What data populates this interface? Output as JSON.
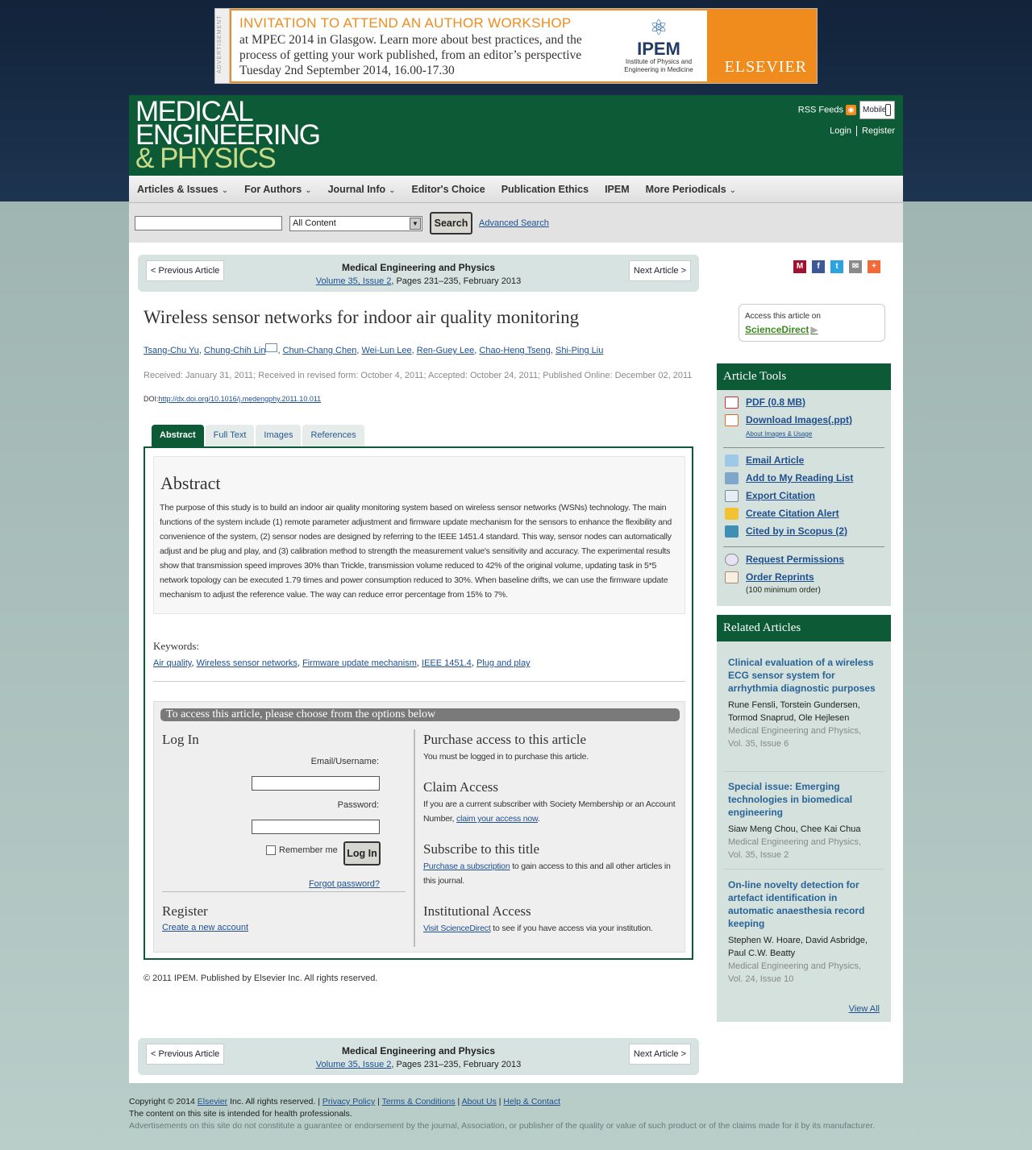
{
  "ad": {
    "side_label": "ADVERTISEMENT",
    "title": "INVITATION TO ATTEND AN AUTHOR WORKSHOP",
    "body": "at MPEC 2014 in Glasgow. Learn more about best practices, and the process of getting your work published, from an editor’s perspective Tuesday 2nd September 2014, 16.00-17.30",
    "logo_name": "IPEM",
    "logo_sub": "Institute of Physics and Engineering in Medicine",
    "publisher": "ELSEVIER"
  },
  "header": {
    "logo_line1": "MEDICAL",
    "logo_line2": "ENGINEERING",
    "logo_line3": "& PHYSICS",
    "rss": "RSS Feeds",
    "mobile": "Mobile",
    "login": "Login",
    "register": "Register"
  },
  "nav": [
    {
      "label": "Articles & Issues",
      "caret": "⌄"
    },
    {
      "label": "For Authors",
      "caret": "⌄"
    },
    {
      "label": "Journal Info",
      "caret": "⌄"
    },
    {
      "label": "Editor's Choice",
      "caret": ""
    },
    {
      "label": "Publication Ethics",
      "caret": ""
    },
    {
      "label": "IPEM",
      "caret": ""
    },
    {
      "label": "More Periodicals",
      "caret": "⌄"
    }
  ],
  "search": {
    "value": "",
    "scope": "All Content",
    "button": "Search",
    "advanced": "Advanced Search"
  },
  "artnav": {
    "prev": "< Previous Article",
    "next": "Next Article >",
    "journal": "Medical Engineering and Physics",
    "volume_link": "Volume 35, Issue 2",
    "pages": ", Pages 231–235, February 2013"
  },
  "article": {
    "title": "Wireless sensor networks for indoor air quality monitoring",
    "authors": [
      "Tsang-Chu Yu",
      "Chung-Chih Lin",
      "Chun-Chang Chen",
      "Wei-Lun Lee",
      "Ren-Guey Lee",
      "Chao-Heng Tseng",
      "Shi-Ping Liu"
    ],
    "dates": "Received: January 31, 2011; Received in revised form: October 4, 2011; Accepted: October 24, 2011; Published Online: December 02, 2011",
    "doi_label": "DOI:",
    "doi": "http://dx.doi.org/10.1016/j.medengphy.2011.10.011",
    "tabs": [
      "Abstract",
      "Full Text",
      "Images",
      "References"
    ],
    "abstract_heading": "Abstract",
    "abstract": "The purpose of this study is to build an indoor air quality monitoring system based on wireless sensor networks (WSNs) technology. The main functions of the system include (1) remote parameter adjustment and firmware update mechanism for the sensors to enhance the flexibility and convenience of the system, (2) sensor nodes are designed by referring to the IEEE 1451.4 standard. This way, sensor nodes can automatically adjust and be plug and play, and (3) calibration method to strength the measurement value's sensitivity and accuracy. The experimental results show that transmission speed improves 30% than Trickle, transmission volume reduced to 42% of the original volume, updating task in 5*5 network topology can be executed 1.79 times and power consumption reduced to 30%. When baseline drifts, we can use the firmware update mechanism to adjust the reference value. The way can reduce error percentage from 15% to 7%.",
    "keywords_label": "Keywords:",
    "keywords": [
      "Air quality",
      "Wireless sensor networks",
      "Firmware update mechanism",
      "IEEE 1451.4",
      "Plug and play"
    ],
    "copyright": "© 2011 IPEM. Published by Elsevier Inc. All rights reserved."
  },
  "access": {
    "bar": "To access this article, please choose from the options below",
    "login_heading": "Log In",
    "email_label": "Email/Username:",
    "password_label": "Password:",
    "remember": "Remember me",
    "login_button": "Log In",
    "forgot": "Forgot password?",
    "register_heading": "Register",
    "register_link": "Create a new account",
    "purchase_heading": "Purchase access to this article",
    "purchase_text": "You must be logged in to purchase this article.",
    "claim_heading": "Claim Access",
    "claim_text": "If you are a current subscriber with Society Membership or an Account Number,",
    "claim_link": "claim your access now",
    "subscribe_heading": "Subscribe to this title",
    "subscribe_link": "Purchase a subscription",
    "subscribe_text": "to gain access to this and all other articles in this journal.",
    "inst_heading": "Institutional Access",
    "inst_link": "Visit ScienceDirect",
    "inst_text": "to see if you have access via your institution."
  },
  "sidebar": {
    "sd_label": "Access this article on",
    "sd_link": "ScienceDirect",
    "tools_heading": "Article Tools",
    "pdf": "PDF (0.8 MB)",
    "download_images": "Download Images(.ppt)",
    "about_images": "About Images & Usage",
    "email_article": "Email Article",
    "reading_list": "Add to My Reading List",
    "export_citation": "Export Citation",
    "citation_alert": "Create Citation Alert",
    "cited_scopus": "Cited by in Scopus (2)",
    "permissions": "Request Permissions",
    "reprints": "Order Reprints",
    "reprints_note": "(100 minimum order)",
    "related_heading": "Related Articles",
    "related": [
      {
        "title": "Clinical evaluation of a wireless ECG sensor system for arrhythmia diagnostic purposes",
        "authors": "Rune Fensli, Torstein Gundersen, Tormod Snaprud, Ole Hejlesen",
        "journal": "Medical Engineering and Physics, Vol. 35, Issue 6"
      },
      {
        "title": "Special issue: Emerging technologies in biomedical engineering",
        "authors": "Siaw Meng Chou, Chee Kai Chua",
        "journal": "Medical Engineering and Physics, Vol. 35, Issue 2"
      },
      {
        "title": "On-line novelty detection for artefact identification in automatic anaesthesia record keeping",
        "authors": "Stephen W. Hoare, David Asbridge, Paul C.W. Beatty",
        "journal": "Medical Engineering and Physics, Vol. 24, Issue 10"
      }
    ],
    "view_all": "View All"
  },
  "footer": {
    "copyright_prefix": "Copyright © 2014",
    "elsevier": "Elsevier",
    "copyright_suffix": "Inc. All rights reserved.",
    "privacy": "Privacy Policy",
    "terms": "Terms & Conditions",
    "about": "About Us",
    "help": "Help & Contact",
    "line2": "The content on this site is intended for health professionals.",
    "disclaimer": "Advertisements on this site do not constitute a guarantee or endorsement by the journal, Association, or publisher of the quality or value of such product or of the claims made for it by its manufacturer."
  },
  "colors": {
    "brand_green": "#0c5a36",
    "ad_orange": "#f08b1d",
    "link_blue": "#1f4f8f"
  },
  "icons": [
    "rss-icon",
    "mobile-phone-icon",
    "mendeley-icon",
    "facebook-icon",
    "twitter-icon",
    "email-share-icon",
    "addthis-icon",
    "pdf-icon",
    "ppt-icon",
    "email-icon",
    "reading-list-icon",
    "export-icon",
    "alert-icon",
    "scopus-icon",
    "copyright-icon",
    "reprints-icon"
  ]
}
